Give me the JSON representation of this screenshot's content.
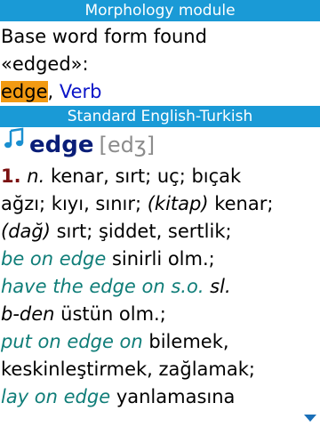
{
  "morphology": {
    "header": "Morphology module",
    "message_line1": "Base word form found",
    "message_line2": "«edged»:",
    "base_word": "edge",
    "separator": ", ",
    "part_of_speech": "Verb"
  },
  "dictionary": {
    "header": "Standard English-Turkish",
    "headword": "edge",
    "transcription": "[edʒ]",
    "icons": {
      "audio": "note-icon",
      "scroll": "scroll-down-arrow"
    },
    "colors": {
      "header_bar": "#1a9ad6",
      "highlight": "#f29a12",
      "headword": "#0a1e78",
      "phrase": "#0f7d78",
      "number": "#7a1010"
    },
    "entry": {
      "l1_num": "1.",
      "l1_pos": "n.",
      "l1_text": " kenar, sırt; uç; bıçak",
      "l2_text_a": "ağzı; kıyı, sınır; ",
      "l2_label": "(kitap)",
      "l2_text_b": " kenar;",
      "l3_label": "(dağ)",
      "l3_text": " sırt; şiddet, sertlik;",
      "l4_phrase": "be on edge",
      "l4_text": " sinirli olm.;",
      "l5_phrase": "have the edge on s.o.",
      "l5_label": " sl.",
      "l6_label": "b-den",
      "l6_text": " üstün olm.;",
      "l7_phrase": "put on edge on",
      "l7_text": " bilemek,",
      "l8_text": "keskinleştirmek, zağlamak;",
      "l9_phrase": "lay on edge",
      "l9_text": " yanlamasına"
    }
  }
}
